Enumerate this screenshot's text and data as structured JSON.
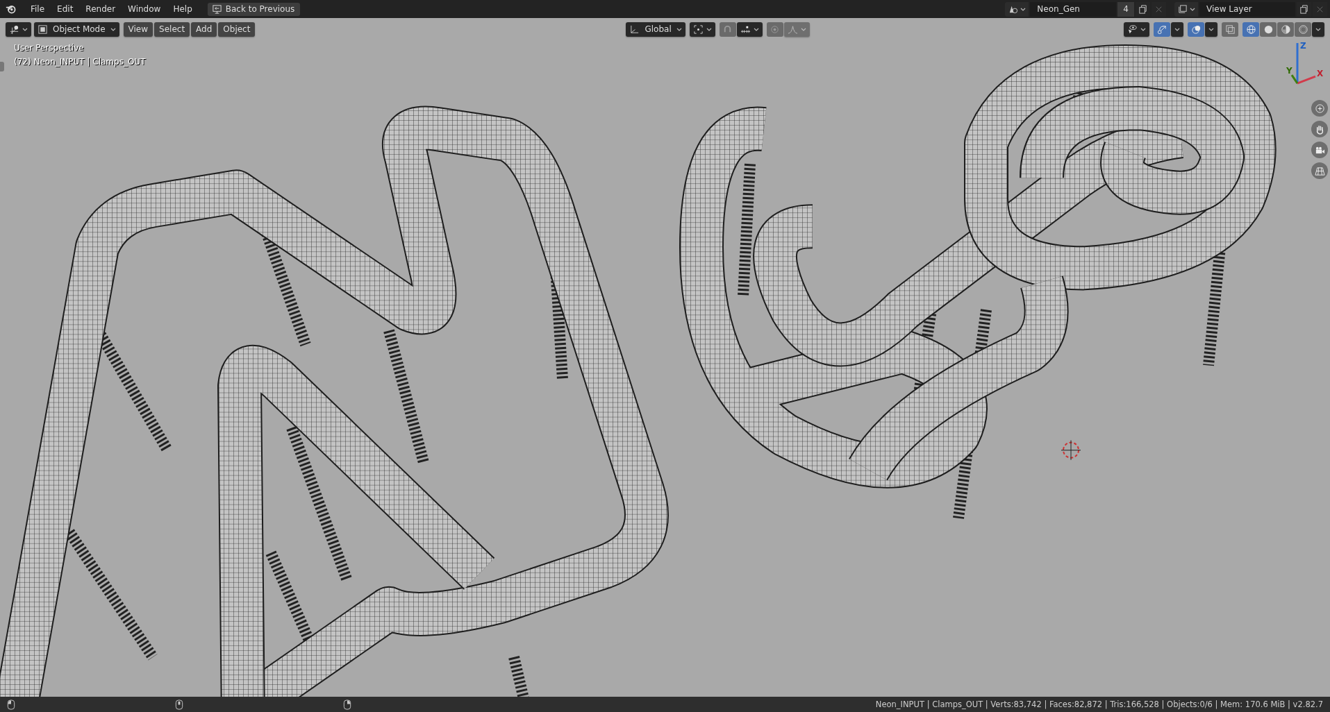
{
  "menu_bar": {
    "menus": [
      "File",
      "Edit",
      "Render",
      "Window",
      "Help"
    ],
    "back_button": "Back to Previous",
    "scene": {
      "name": "Neon_Gen",
      "users": "4"
    },
    "view_layer": {
      "name": "View Layer"
    }
  },
  "viewport_header": {
    "mode": "Object Mode",
    "menus": [
      "View",
      "Select",
      "Add",
      "Object"
    ],
    "orientation": "Global",
    "snap": {
      "on": false
    },
    "proportional_editing": {
      "on": false
    },
    "gizmos": {
      "on": true
    },
    "overlays": {
      "on": true
    },
    "xray": {
      "on": false
    },
    "shading_modes": [
      {
        "kind": "wireframe",
        "selected": true
      },
      {
        "kind": "solid",
        "selected": false
      },
      {
        "kind": "material",
        "selected": false
      },
      {
        "kind": "rendered",
        "selected": false
      }
    ]
  },
  "viewport": {
    "view_name": "User Perspective",
    "object_info": "(72) Neon_INPUT | Clamps_OUT",
    "axis_labels": [
      "Y",
      "Z",
      "X"
    ]
  },
  "status_bar": {
    "stats": "Neon_INPUT | Clamps_OUT | Verts:83,742 | Faces:82,872 | Tris:166,528 | Objects:0/6 | Mem: 170.6 MiB | v2.82.7"
  }
}
